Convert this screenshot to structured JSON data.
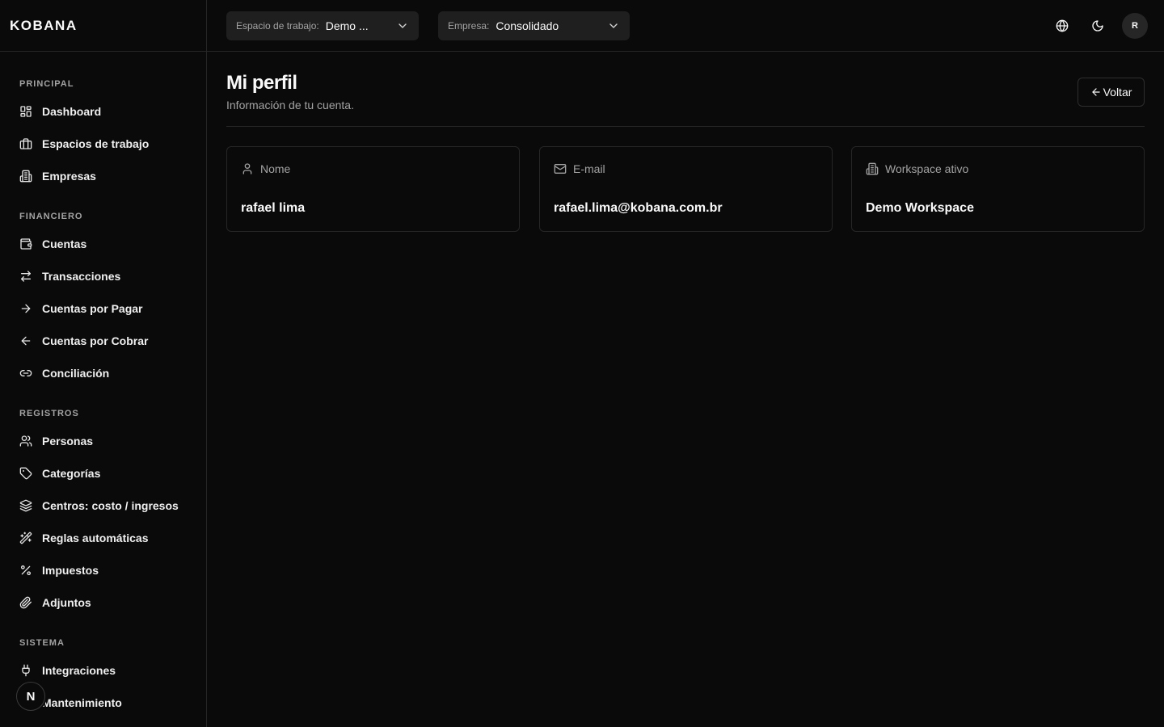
{
  "brand": {
    "logo": "KOBANA"
  },
  "header": {
    "workspace_select": {
      "label": "Espacio de trabajo:",
      "value": "Demo ..."
    },
    "company_select": {
      "label": "Empresa:",
      "value": "Consolidado"
    },
    "avatar_initial": "R"
  },
  "sidebar": {
    "sections": [
      {
        "title": "PRINCIPAL",
        "items": [
          {
            "label": "Dashboard",
            "icon": "dashboard-icon"
          },
          {
            "label": "Espacios de trabajo",
            "icon": "briefcase-icon"
          },
          {
            "label": "Empresas",
            "icon": "building-icon"
          }
        ]
      },
      {
        "title": "FINANCIERO",
        "items": [
          {
            "label": "Cuentas",
            "icon": "wallet-icon"
          },
          {
            "label": "Transacciones",
            "icon": "arrows-left-right-icon"
          },
          {
            "label": "Cuentas por Pagar",
            "icon": "arrow-right-icon"
          },
          {
            "label": "Cuentas por Cobrar",
            "icon": "arrow-left-icon"
          },
          {
            "label": "Conciliación",
            "icon": "link-icon"
          }
        ]
      },
      {
        "title": "REGISTROS",
        "items": [
          {
            "label": "Personas",
            "icon": "users-icon"
          },
          {
            "label": "Categorías",
            "icon": "tag-icon"
          },
          {
            "label": "Centros: costo / ingresos",
            "icon": "layers-icon"
          },
          {
            "label": "Reglas automáticas",
            "icon": "wand-icon"
          },
          {
            "label": "Impuestos",
            "icon": "percent-icon"
          },
          {
            "label": "Adjuntos",
            "icon": "paperclip-icon"
          }
        ]
      },
      {
        "title": "SISTEMA",
        "items": [
          {
            "label": "Integraciones",
            "icon": "plug-icon"
          },
          {
            "label": "Mantenimiento",
            "icon": "wrench-icon"
          }
        ]
      }
    ],
    "floating_badge": "N"
  },
  "main": {
    "title": "Mi perfil",
    "subtitle": "Información de tu cuenta.",
    "back_button": "Voltar",
    "cards": [
      {
        "label": "Nome",
        "value": "rafael lima",
        "icon": "user-icon"
      },
      {
        "label": "E-mail",
        "value": "rafael.lima@kobana.com.br",
        "icon": "mail-icon"
      },
      {
        "label": "Workspace ativo",
        "value": "Demo Workspace",
        "icon": "building-icon"
      }
    ]
  }
}
